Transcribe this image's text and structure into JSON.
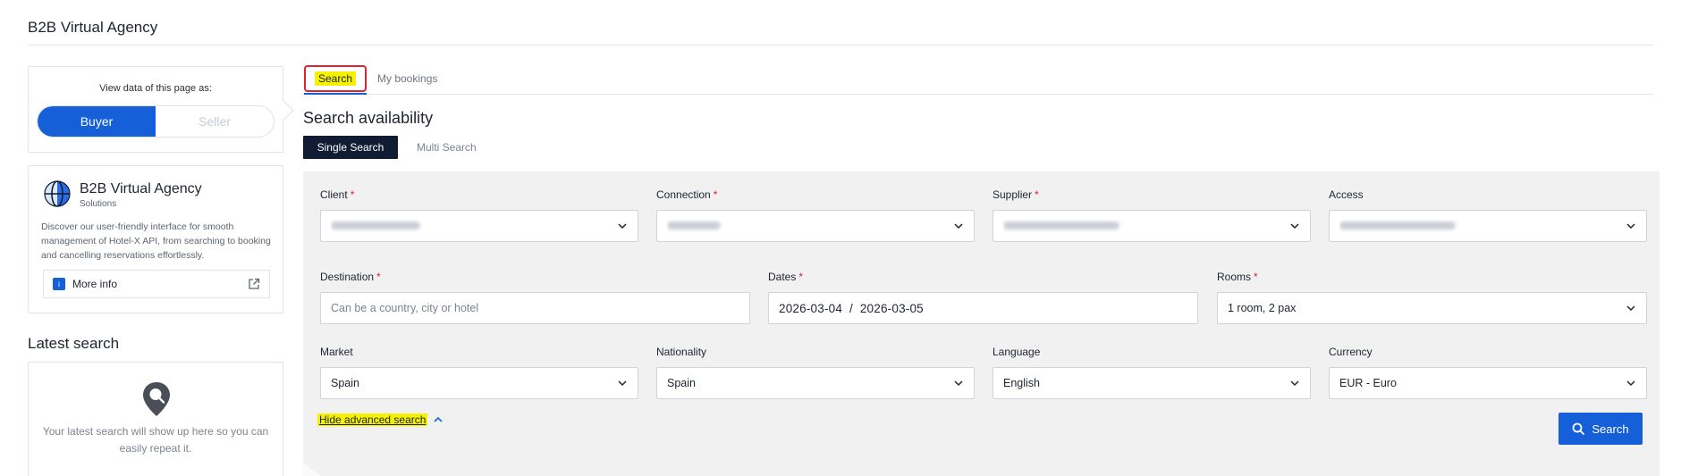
{
  "app": {
    "title": "B2B Virtual Agency"
  },
  "view_as": {
    "label": "View data of this page as:",
    "options": [
      "Buyer",
      "Seller"
    ],
    "selected": "Buyer"
  },
  "info_card": {
    "title": "B2B Virtual Agency",
    "subtitle": "Solutions",
    "description": "Discover our user-friendly interface for smooth management of Hotel-X API, from searching to booking and cancelling reservations effortlessly.",
    "more_info": "More info"
  },
  "latest_search": {
    "title": "Latest search",
    "empty_text": "Your latest search will show up here so you can easily repeat it."
  },
  "tabs": [
    {
      "label": "Search",
      "active": true
    },
    {
      "label": "My bookings",
      "active": false
    }
  ],
  "search": {
    "title": "Search availability",
    "modes": [
      "Single Search",
      "Multi Search"
    ],
    "active_mode": "Single Search"
  },
  "form": {
    "client": {
      "label": "Client",
      "required": true
    },
    "connection": {
      "label": "Connection",
      "required": true
    },
    "supplier": {
      "label": "Supplier",
      "required": true
    },
    "access": {
      "label": "Access",
      "required": false
    },
    "destination": {
      "label": "Destination",
      "required": true,
      "placeholder": "Can be a country, city or hotel"
    },
    "dates": {
      "label": "Dates",
      "required": true,
      "start": "2026-03-04",
      "separator": "/",
      "end": "2026-03-05"
    },
    "rooms": {
      "label": "Rooms",
      "required": true,
      "value": "1 room, 2 pax"
    },
    "market": {
      "label": "Market",
      "value": "Spain"
    },
    "nationality": {
      "label": "Nationality",
      "value": "Spain"
    },
    "language": {
      "label": "Language",
      "value": "English"
    },
    "currency": {
      "label": "Currency",
      "value": "EUR - Euro"
    }
  },
  "advanced_link": "Hide advanced search",
  "search_button": "Search",
  "colors": {
    "primary": "#1560d8",
    "dark_button": "#0f1c33",
    "required": "#e0242f",
    "highlight": "#f6f100",
    "panel_bg": "#f1f1f2"
  },
  "icons": [
    "globe-logo-icon",
    "external-link-icon",
    "location-pin-icon",
    "chevron-down-icon",
    "chevron-up-icon",
    "search-icon"
  ]
}
